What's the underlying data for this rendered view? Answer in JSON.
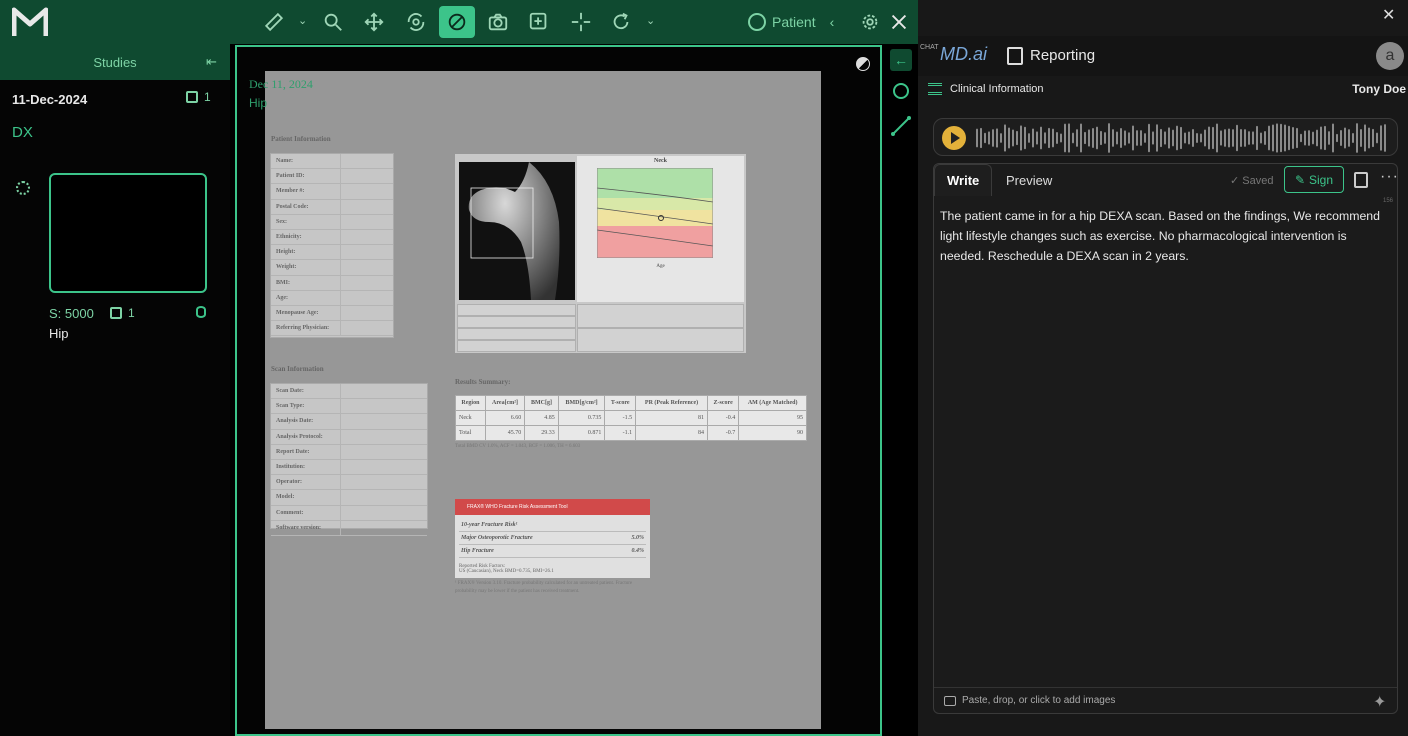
{
  "toolbar": {
    "tools": [
      "measure-icon",
      "zoom-icon",
      "pan-icon",
      "rotate-icon",
      "window-level-icon",
      "camera-icon",
      "add-series-icon",
      "crosshair-icon",
      "reset-icon"
    ],
    "patient_label": "Patient",
    "accent": "#3cc48a"
  },
  "sidebar": {
    "title": "Studies",
    "study_date": "11-Dec-2024",
    "study_count": "1",
    "modality": "DX",
    "series_number": "S: 5000",
    "series_count": "1",
    "series_desc": "Hip"
  },
  "viewer": {
    "overlay_date": "Dec 11, 2024",
    "overlay_body": "Hip",
    "doc": {
      "patient_section": "Patient Information",
      "patient_fields": [
        "Name:",
        "Patient ID:",
        "Member #:",
        "Postal Code:",
        "Sex:",
        "Ethnicity:",
        "Height:",
        "Weight:",
        "BMI:",
        "Age:",
        "Menopause Age:",
        "Referring Physician:"
      ],
      "scan_section": "Scan Information",
      "scan_fields": [
        "Scan Date:",
        "Scan Type:",
        "Analysis Date:",
        "Analysis Protocol:",
        "Report Date:",
        "Institution:",
        "Operator:",
        "Model:",
        "Comment:",
        "Software version:"
      ],
      "graph_title": "Neck",
      "graph_xlabel": "Age",
      "results_section": "Results Summary:",
      "results_headers": [
        "Region",
        "Area[cm²]",
        "BMC[g]",
        "BMD[g/cm²]",
        "T-score",
        "PR (Peak Reference)",
        "Z-score",
        "AM (Age Matched)"
      ],
      "results_rows": [
        [
          "Neck",
          "6.60",
          "4.85",
          "0.735",
          "-1.5",
          "81",
          "-0.4",
          "95"
        ],
        [
          "Total",
          "45.70",
          "29.33",
          "0.871",
          "-1.1",
          "84",
          "-0.7",
          "90"
        ]
      ],
      "results_note": "Total BMD CV 1.0%, ACF = 1.043, BCF = 1.006, TH = 6.603",
      "frax_head": "FRAX® WHO Fracture Risk Assessment Tool",
      "frax_title": "10-year Fracture Risk¹",
      "frax_rows": [
        {
          "label": "Major Osteoporotic Fracture",
          "value": "5.0%"
        },
        {
          "label": "Hip Fracture",
          "value": "0.4%"
        }
      ],
      "frax_factors": "Reported Risk Factors:",
      "frax_factors_detail": "US (Caucasian), Neck BMD=0.735, BMI=26.1",
      "frax_footnote": "¹ FRAX® Version 3.10. Fracture probability calculated for an untreated patient. Fracture probability may be lower if the patient has received treatment."
    }
  },
  "report": {
    "chat_tag": "CHAT",
    "brand": "MD.ai",
    "title": "Reporting",
    "avatar": "a",
    "clinical_label": "Clinical Information",
    "patient_name": "Tony Doe",
    "tab_write": "Write",
    "tab_preview": "Preview",
    "saved_label": "✓ Saved",
    "sign_label": "Sign",
    "char_count": "156",
    "text": "The patient came in for a hip DEXA scan. Based on the findings, We recommend light lifestyle changes such as exercise. No pharmacological intervention is needed. Reschedule a DEXA scan in 2 years.",
    "images_label": "Paste, drop, or click to add images"
  }
}
